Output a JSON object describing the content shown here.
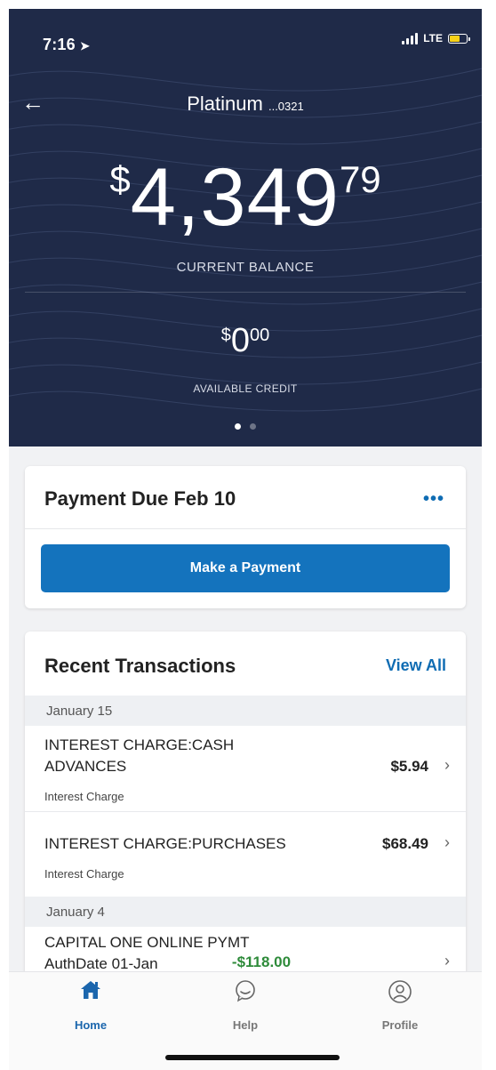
{
  "status": {
    "time": "7:16",
    "network": "LTE"
  },
  "header": {
    "account_name": "Platinum",
    "account_number": "...0321",
    "balance_dollar_sign": "$",
    "balance_whole": "4,349",
    "balance_cents": "79",
    "balance_label": "CURRENT BALANCE",
    "credit_dollar_sign": "$",
    "credit_whole": "0",
    "credit_cents": "00",
    "credit_label": "AVAILABLE CREDIT",
    "page_dots": 2,
    "active_dot": 1
  },
  "payment": {
    "title": "Payment Due Feb 10",
    "more_label": "•••",
    "button_label": "Make a Payment"
  },
  "transactions": {
    "title": "Recent Transactions",
    "view_all_label": "View All",
    "groups": [
      {
        "date": "January 15",
        "items": [
          {
            "description": "INTEREST CHARGE:CASH ADVANCES",
            "category": "Interest Charge",
            "amount": "$5.94"
          },
          {
            "description": "INTEREST CHARGE:PURCHASES",
            "category": "Interest Charge",
            "amount": "$68.49"
          }
        ]
      },
      {
        "date": "January 4",
        "items": [
          {
            "description": "CAPITAL ONE ONLINE PYMT AuthDate 01-Jan",
            "category": "",
            "amount": "-$118.00"
          }
        ]
      }
    ]
  },
  "tabbar": {
    "tabs": [
      {
        "label": "Home",
        "icon": "home-icon",
        "active": true
      },
      {
        "label": "Help",
        "icon": "chat-bubble-icon",
        "active": false
      },
      {
        "label": "Profile",
        "icon": "profile-icon",
        "active": false
      }
    ]
  },
  "colors": {
    "header_bg": "#1f2a48",
    "accent": "#1473bd",
    "link": "#0f6cb3",
    "credit_amount": "#2e8b3a",
    "battery": "#f7d117"
  }
}
